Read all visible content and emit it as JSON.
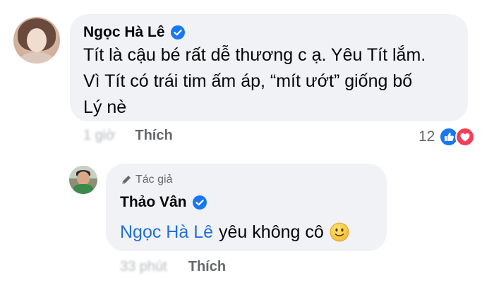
{
  "comment": {
    "author": "Ngọc Hà Lê",
    "avatar_icon": "profile-photo",
    "verified_icon": "verified-badge-icon",
    "text_lines": [
      "Tít là cậu bé rất dễ thương c ạ. Yêu Tít lắm.",
      "Vì Tít có trái tim ấm áp, “mít ướt” giống bố",
      "Lý nè"
    ],
    "time": "1 giờ",
    "like_label": "Thích",
    "reaction_count": "12",
    "reaction_icons": [
      "like-reaction-icon",
      "love-reaction-icon"
    ]
  },
  "reply": {
    "author_badge": "Tác giả",
    "author": "Thảo Vân",
    "mention": "Ngọc Hà Lê",
    "text": "yêu không cô",
    "emoji_icon": "slightly-smiling-face-icon",
    "time": "33 phút",
    "like_label": "Thích"
  },
  "colors": {
    "bubble": "#f0f2f5",
    "text": "#050505",
    "secondary": "#65676b",
    "mention": "#216fdb",
    "like_blue": "#1877f2",
    "love_red": "#f33e58"
  }
}
